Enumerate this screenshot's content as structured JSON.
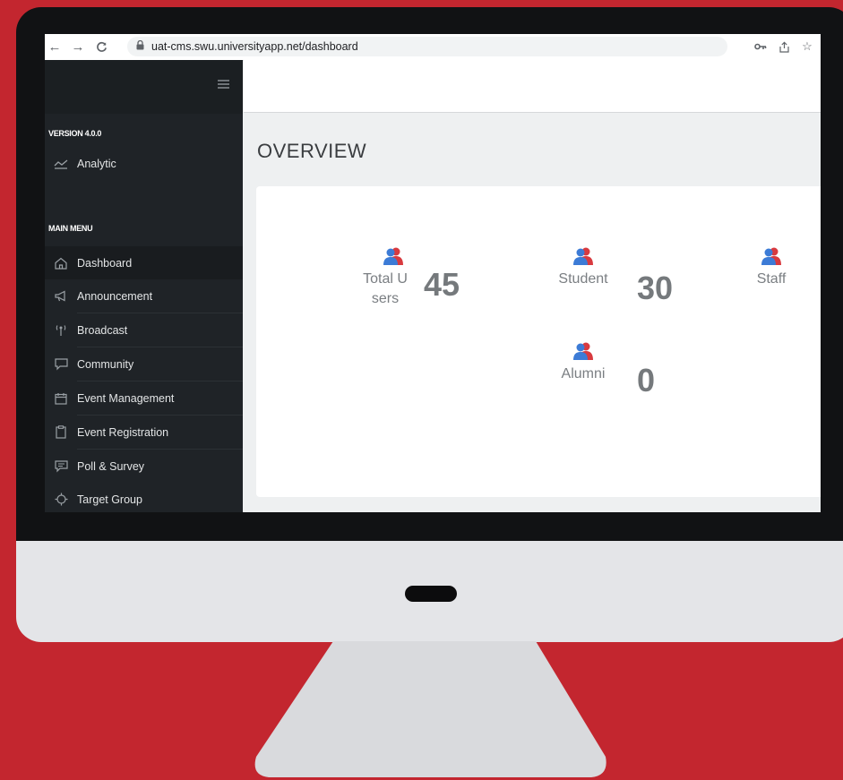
{
  "browser": {
    "url": "uat-cms.swu.universityapp.net/dashboard",
    "nav_icons": [
      "back-arrow-icon",
      "forward-arrow-icon",
      "reload-icon"
    ],
    "right_icons": [
      "key-icon",
      "share-icon",
      "star-icon"
    ]
  },
  "sidebar": {
    "version_label": "VERSION 4.0.0",
    "analytic_label": "Analytic",
    "main_menu_label": "MAIN MENU",
    "items": [
      {
        "label": "Dashboard",
        "icon": "home-icon"
      },
      {
        "label": "Announcement",
        "icon": "megaphone-icon"
      },
      {
        "label": "Broadcast",
        "icon": "antenna-icon"
      },
      {
        "label": "Community",
        "icon": "chat-icon"
      },
      {
        "label": "Event Management",
        "icon": "calendar-icon"
      },
      {
        "label": "Event Registration",
        "icon": "clipboard-icon"
      },
      {
        "label": "Poll & Survey",
        "icon": "message-icon"
      },
      {
        "label": "Target Group",
        "icon": "crosshair-icon"
      }
    ],
    "active_item": "Dashboard"
  },
  "main": {
    "title": "OVERVIEW",
    "stats": [
      {
        "label_line1": "Total U",
        "label_line2": "sers",
        "value": "45"
      },
      {
        "label_line1": "Student",
        "label_line2": "",
        "value": "30"
      },
      {
        "label_line1": "Staff",
        "label_line2": "",
        "value": ""
      },
      {
        "label_line1": "Alumni",
        "label_line2": "",
        "value": "0"
      }
    ]
  },
  "colors": {
    "background": "#c3262f",
    "sidebar": "#1f2327",
    "user_icon_blue": "#3c7bd6",
    "user_icon_red": "#d83a3f"
  }
}
